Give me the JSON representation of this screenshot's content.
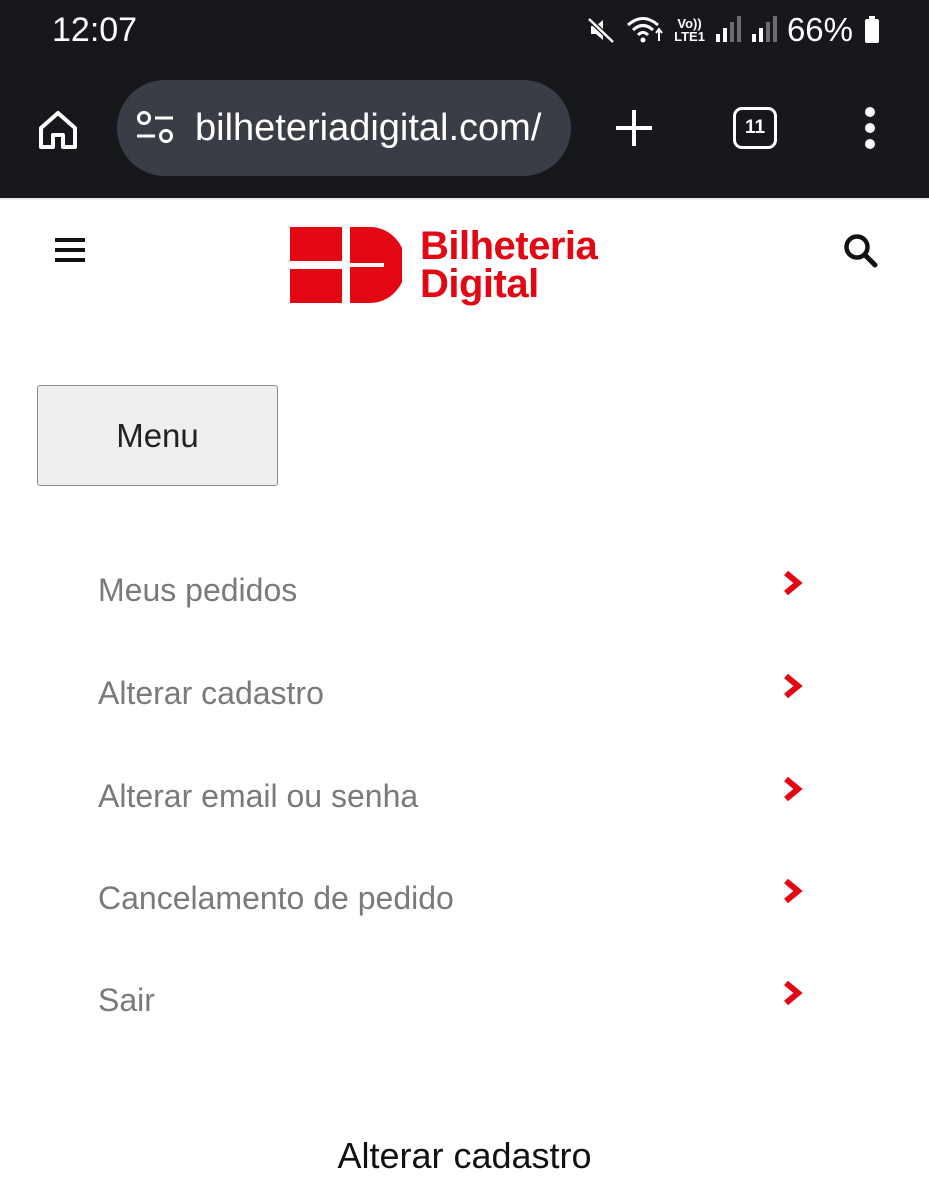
{
  "status_bar": {
    "time": "12:07",
    "battery": "66%",
    "network_line1": "Vo))",
    "network_line2": "LTE1",
    "icons": [
      "mute-icon",
      "wifi-icon",
      "signal-icon",
      "signal-icon",
      "battery-icon"
    ]
  },
  "browser": {
    "url": "bilheteriadigital.com/",
    "tab_count": "11",
    "icons": [
      "home-icon",
      "tune-icon",
      "plus-icon",
      "more-vert-icon"
    ]
  },
  "site": {
    "brand_line1": "Bilheteria",
    "brand_line2": "Digital",
    "brand_color": "#e30613",
    "icons": [
      "hamburger-icon",
      "search-icon"
    ]
  },
  "menu_button_label": "Menu",
  "account_menu": {
    "items": [
      {
        "label": "Meus pedidos"
      },
      {
        "label": "Alterar cadastro"
      },
      {
        "label": "Alterar email ou senha"
      },
      {
        "label": "Cancelamento de pedido"
      },
      {
        "label": "Sair"
      }
    ],
    "chevron_icon": "chevron-right-icon",
    "chevron_color": "#e30613"
  },
  "section_heading": "Alterar cadastro"
}
